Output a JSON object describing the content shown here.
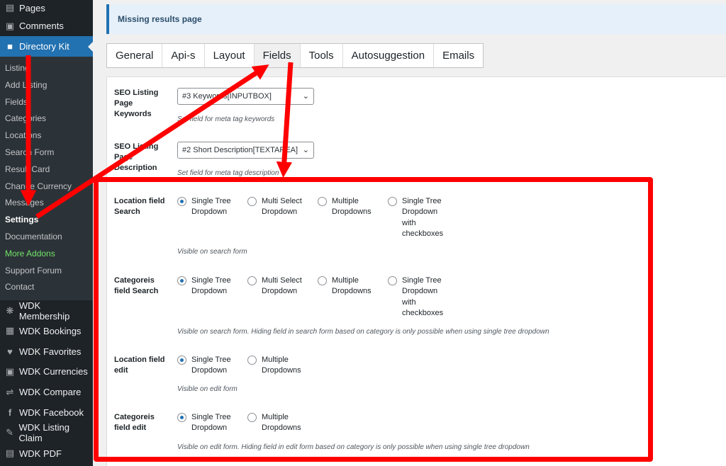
{
  "sidebar": {
    "pages": "Pages",
    "comments": "Comments",
    "current": "Directory Kit",
    "submenu": [
      "Listing",
      "Add Listing",
      "Fields",
      "Categories",
      "Locations",
      "Search Form",
      "Result Card",
      "Change Currency",
      "Messages",
      "Settings",
      "Documentation",
      "More Addons",
      "Support Forum",
      "Contact"
    ],
    "plugins": [
      "WDK Membership",
      "WDK Bookings",
      "WDK Favorites",
      "WDK Currencies",
      "WDK Compare",
      "WDK Facebook",
      "WDK Listing Claim",
      "WDK PDF"
    ],
    "colors": {
      "bg": "#1d2327",
      "current": "#2271b1",
      "addons": "#72e36b"
    }
  },
  "notice": {
    "text": "Missing results page"
  },
  "tabs": [
    "General",
    "Api-s",
    "Layout",
    "Fields",
    "Tools",
    "Autosuggestion",
    "Emails"
  ],
  "active_tab": "Fields",
  "settings": {
    "seo_keywords": {
      "label": "SEO Listing Page Keywords",
      "value": "#3 Keywords[INPUTBOX]",
      "desc": "Set field for meta tag keywords"
    },
    "seo_description": {
      "label": "SEO Listing Page Description",
      "value": "#2 Short Description[TEXTAREA]",
      "desc": "Set field for meta tag description"
    },
    "location_search": {
      "label": "Location field Search",
      "options": [
        "Single Tree Dropdown",
        "Multi Select Dropdown",
        "Multiple Dropdowns",
        "Single Tree Dropdown with checkboxes"
      ],
      "selected": 0,
      "desc": "Visible on search form"
    },
    "categories_search": {
      "label": "Categoreis field Search",
      "options": [
        "Single Tree Dropdown",
        "Multi Select Dropdown",
        "Multiple Dropdowns",
        "Single Tree Dropdown with checkboxes"
      ],
      "selected": 0,
      "desc": "Visible on search form. Hiding field in search form based on category is only possible when using single tree dropdown"
    },
    "location_edit": {
      "label": "Location field edit",
      "options": [
        "Single Tree Dropdown",
        "Multiple Dropdowns"
      ],
      "selected": 0,
      "desc": "Visible on edit form"
    },
    "categories_edit": {
      "label": "Categoreis field edit",
      "options": [
        "Single Tree Dropdown",
        "Multiple Dropdowns"
      ],
      "selected": 0,
      "desc": "Visible on edit form. Hiding field in edit form based on category is only possible when using single tree dropdown"
    }
  },
  "annotation_color": "#ff0000"
}
